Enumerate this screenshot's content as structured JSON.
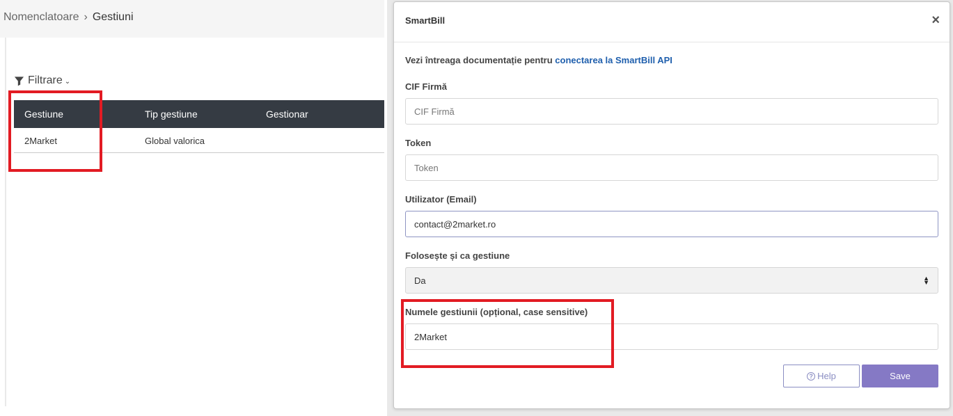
{
  "breadcrumb": {
    "parent": "Nomenclatoare",
    "separator": "›",
    "current": "Gestiuni"
  },
  "filter": {
    "label": "Filtrare"
  },
  "table": {
    "headers": [
      "Gestiune",
      "Tip gestiune",
      "Gestionar"
    ],
    "rows": [
      {
        "gestiune": "2Market",
        "tip": "Global valorica",
        "gestionar": ""
      }
    ]
  },
  "modal": {
    "title": "SmartBill",
    "close": "×",
    "doc_text": "Vezi întreaga documentație pentru",
    "doc_link": "conectarea la SmartBill API",
    "fields": {
      "cif": {
        "label": "CIF Firmă",
        "placeholder": "CIF Firmă",
        "value": ""
      },
      "token": {
        "label": "Token",
        "placeholder": "Token",
        "value": ""
      },
      "email": {
        "label": "Utilizator (Email)",
        "value": "contact@2market.ro"
      },
      "use_as": {
        "label": "Folosește și ca gestiune",
        "value": "Da"
      },
      "warehouse_name": {
        "label": "Numele gestiunii (opțional, case sensitive)",
        "value": "2Market"
      }
    },
    "buttons": {
      "help": "Help",
      "save": "Save"
    }
  },
  "colors": {
    "header_dark": "#353b43",
    "highlight": "#e21b23",
    "save_button": "#8579c5",
    "link": "#1f5fad"
  }
}
